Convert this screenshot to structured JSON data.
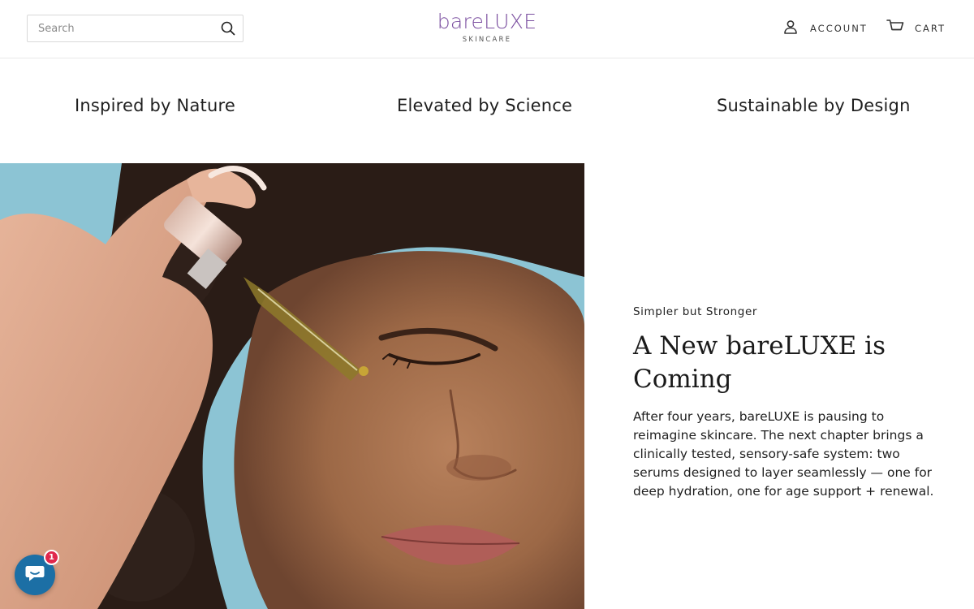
{
  "header": {
    "search": {
      "placeholder": "Search",
      "value": "",
      "icon": "search-icon"
    },
    "logo": {
      "main": "bareLUXE",
      "sub": "SKINCARE",
      "color": "#7b4fa0"
    },
    "account": {
      "label": "ACCOUNT",
      "icon": "person-icon"
    },
    "cart": {
      "label": "CART",
      "icon": "cart-icon"
    }
  },
  "taglines": [
    "Inspired by Nature",
    "Elevated by Science",
    "Sustainable by Design"
  ],
  "hero": {
    "eyebrow": "Simpler but Stronger",
    "headline": "A New bareLUXE is Coming",
    "body": "After four years, bareLUXE is pausing to reimagine skincare. The next chapter brings a clinically tested, sensory-safe system: two serums designed to layer seamlessly — one for deep hydration, one for age support + renewal."
  },
  "chat": {
    "icon": "chat-bubble-icon",
    "badge_count": "1",
    "color": "#1c6fa5"
  }
}
